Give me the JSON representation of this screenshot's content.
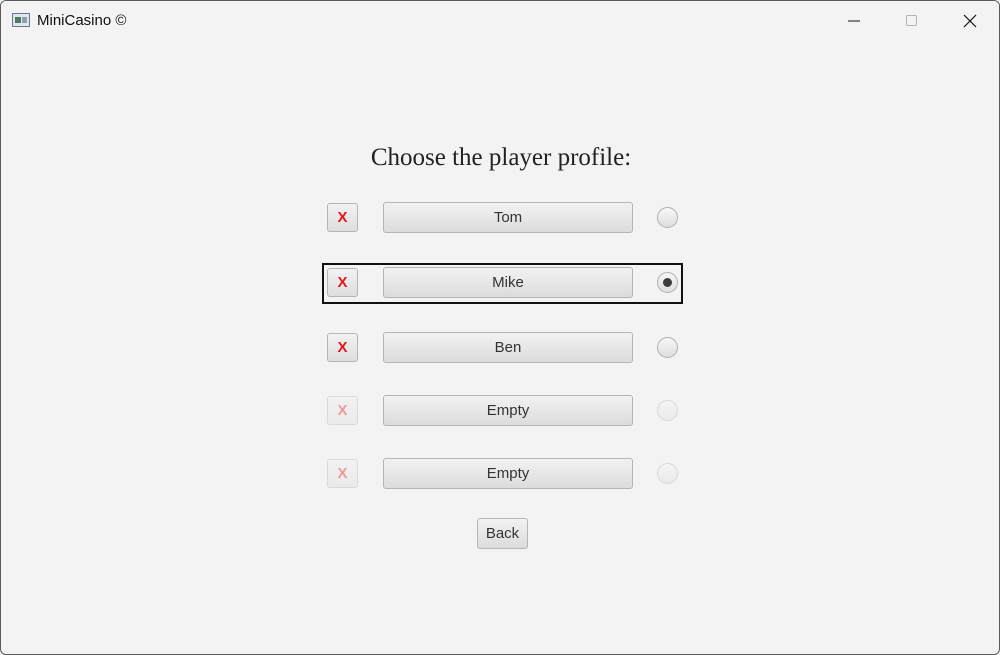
{
  "window": {
    "title": "MiniCasino ©"
  },
  "heading": "Choose the player profile:",
  "profiles": [
    {
      "name": "Tom",
      "delete_label": "X",
      "selected": false,
      "enabled": true
    },
    {
      "name": "Mike",
      "delete_label": "X",
      "selected": true,
      "enabled": true
    },
    {
      "name": "Ben",
      "delete_label": "X",
      "selected": false,
      "enabled": true
    },
    {
      "name": "Empty",
      "delete_label": "X",
      "selected": false,
      "enabled": false
    },
    {
      "name": "Empty",
      "delete_label": "X",
      "selected": false,
      "enabled": false
    }
  ],
  "back_label": "Back",
  "colors": {
    "delete_accent": "#e8141b",
    "background": "#f3f3f3"
  }
}
